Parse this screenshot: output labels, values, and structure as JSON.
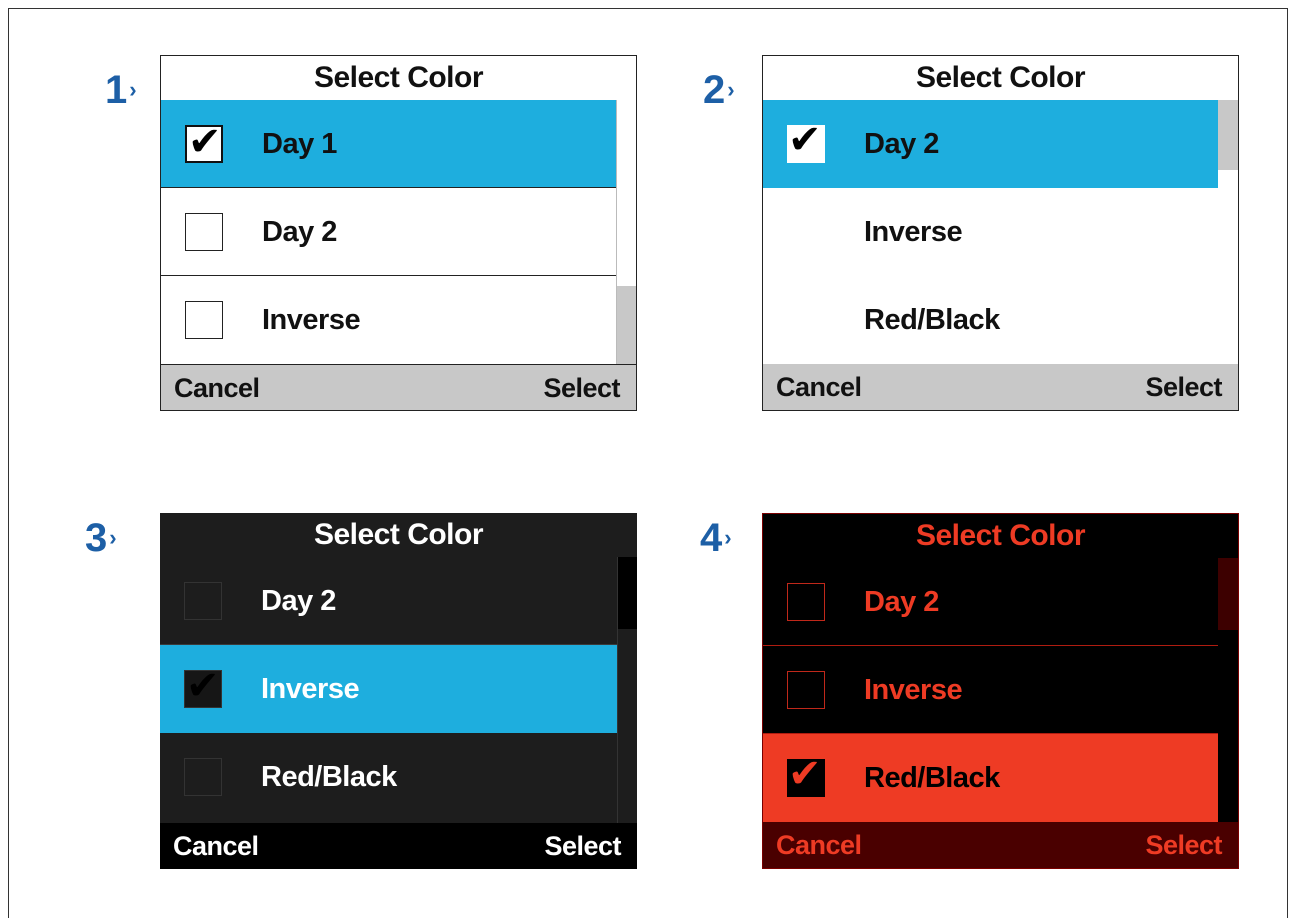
{
  "colors": {
    "step_number": "#1d5fa6",
    "highlight_blue": "#1eaede",
    "red_accent": "#ee3b24",
    "dark_red": "#4a0000"
  },
  "panels": [
    {
      "step": "1",
      "title": "Select Color",
      "items": [
        {
          "label": "Day 1",
          "checked": true
        },
        {
          "label": "Day 2",
          "checked": false
        },
        {
          "label": "Inverse",
          "checked": false
        }
      ],
      "cancel_label": "Cancel",
      "select_label": "Select"
    },
    {
      "step": "2",
      "title": "Select Color",
      "items": [
        {
          "label": "Day 2",
          "checked": true
        },
        {
          "label": "Inverse",
          "checked": false
        },
        {
          "label": "Red/Black",
          "checked": false
        }
      ],
      "cancel_label": "Cancel",
      "select_label": "Select"
    },
    {
      "step": "3",
      "title": "Select Color",
      "items": [
        {
          "label": "Day 2",
          "checked": false
        },
        {
          "label": "Inverse",
          "checked": true
        },
        {
          "label": "Red/Black",
          "checked": false
        }
      ],
      "cancel_label": "Cancel",
      "select_label": "Select"
    },
    {
      "step": "4",
      "title": "Select Color",
      "items": [
        {
          "label": "Day 2",
          "checked": false
        },
        {
          "label": "Inverse",
          "checked": false
        },
        {
          "label": "Red/Black",
          "checked": true
        }
      ],
      "cancel_label": "Cancel",
      "select_label": "Select"
    }
  ]
}
